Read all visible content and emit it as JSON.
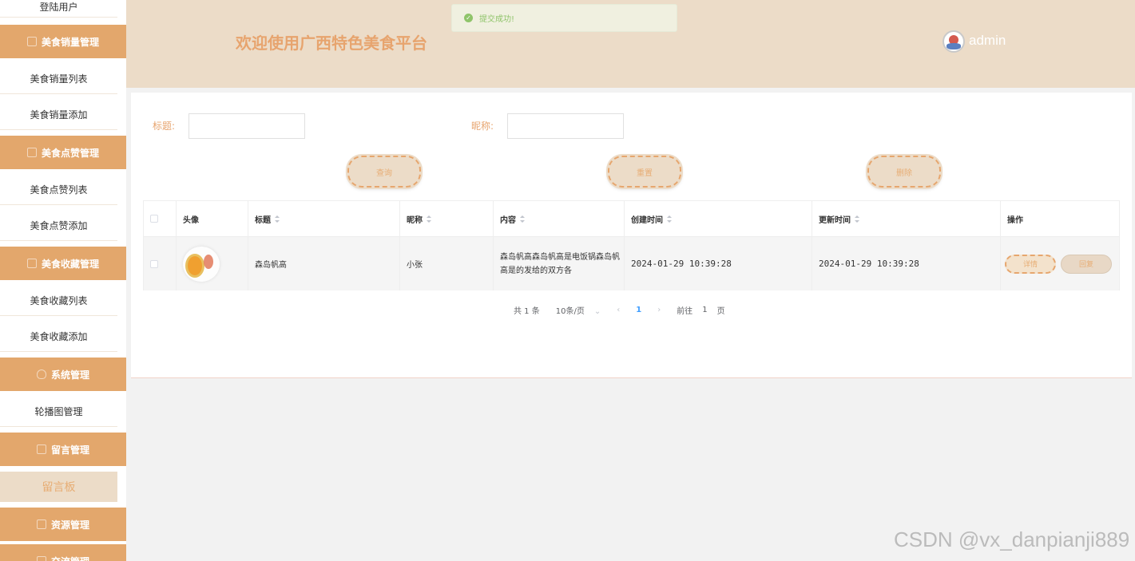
{
  "header": {
    "title": "欢迎使用广西特色美食平台",
    "user": "admin"
  },
  "toast": {
    "message": "提交成功!"
  },
  "sidebar": {
    "top_item": "登陆用户",
    "sales_group": "美食销量管理",
    "sales_list": "美食销量列表",
    "sales_add": "美食销量添加",
    "like_group": "美食点赞管理",
    "like_list": "美食点赞列表",
    "like_add": "美食点赞添加",
    "fav_group": "美食收藏管理",
    "fav_list": "美食收藏列表",
    "fav_add": "美食收藏添加",
    "sys_group": "系统管理",
    "carousel": "轮播图管理",
    "msg_group": "留言管理",
    "msg_board": "留言板",
    "res_group": "资源管理",
    "comm_group": "交流管理"
  },
  "search": {
    "title_label": "标题:",
    "title_value": "",
    "nickname_label": "昵称:",
    "nickname_value": "",
    "query_btn": "查询",
    "reset_btn": "重置",
    "delete_btn": "删除"
  },
  "table": {
    "columns": {
      "avatar": "头像",
      "title": "标题",
      "nickname": "昵称",
      "content": "内容",
      "created": "创建时间",
      "updated": "更新时间",
      "ops": "操作"
    },
    "rows": [
      {
        "title": "森岛帆高",
        "nickname": "小张",
        "content": "森岛帆高森岛帆高是电饭锅森岛帆高是的发给的双方各",
        "created": "2024-01-29 10:39:28",
        "updated": "2024-01-29 10:39:28",
        "detail_btn": "详情",
        "reply_btn": "回复"
      }
    ]
  },
  "pager": {
    "total": "共 1 条",
    "page_size": "10条/页",
    "prev": "‹",
    "current": "1",
    "next": "›",
    "goto_label": "前往",
    "goto_value": "1",
    "page_unit": "页"
  },
  "watermark": "CSDN @vx_danpianji889"
}
